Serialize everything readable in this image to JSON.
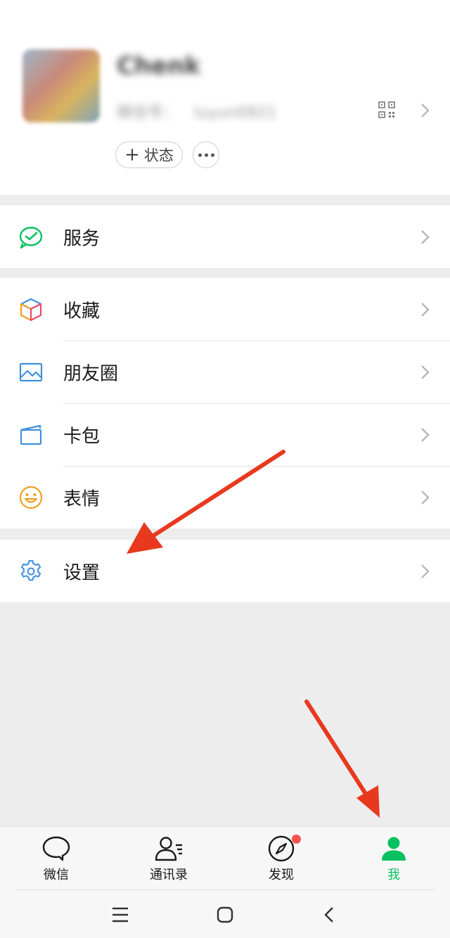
{
  "profile": {
    "nickname": "Chenk",
    "wechat_id_label": "微信号：",
    "wechat_id": "luyun0921",
    "status_label": "状态"
  },
  "menu": {
    "services": "服务",
    "favorites": "收藏",
    "moments": "朋友圈",
    "cards": "卡包",
    "stickers": "表情",
    "settings": "设置"
  },
  "tabs": [
    {
      "label": "微信",
      "icon": "chat-bubble-icon"
    },
    {
      "label": "通讯录",
      "icon": "contacts-icon"
    },
    {
      "label": "发现",
      "icon": "compass-icon"
    },
    {
      "label": "我",
      "icon": "person-icon"
    }
  ],
  "colors": {
    "accent_green": "#07c160",
    "badge_red": "#fa5151",
    "annotation_arrow": "#e8391e"
  }
}
